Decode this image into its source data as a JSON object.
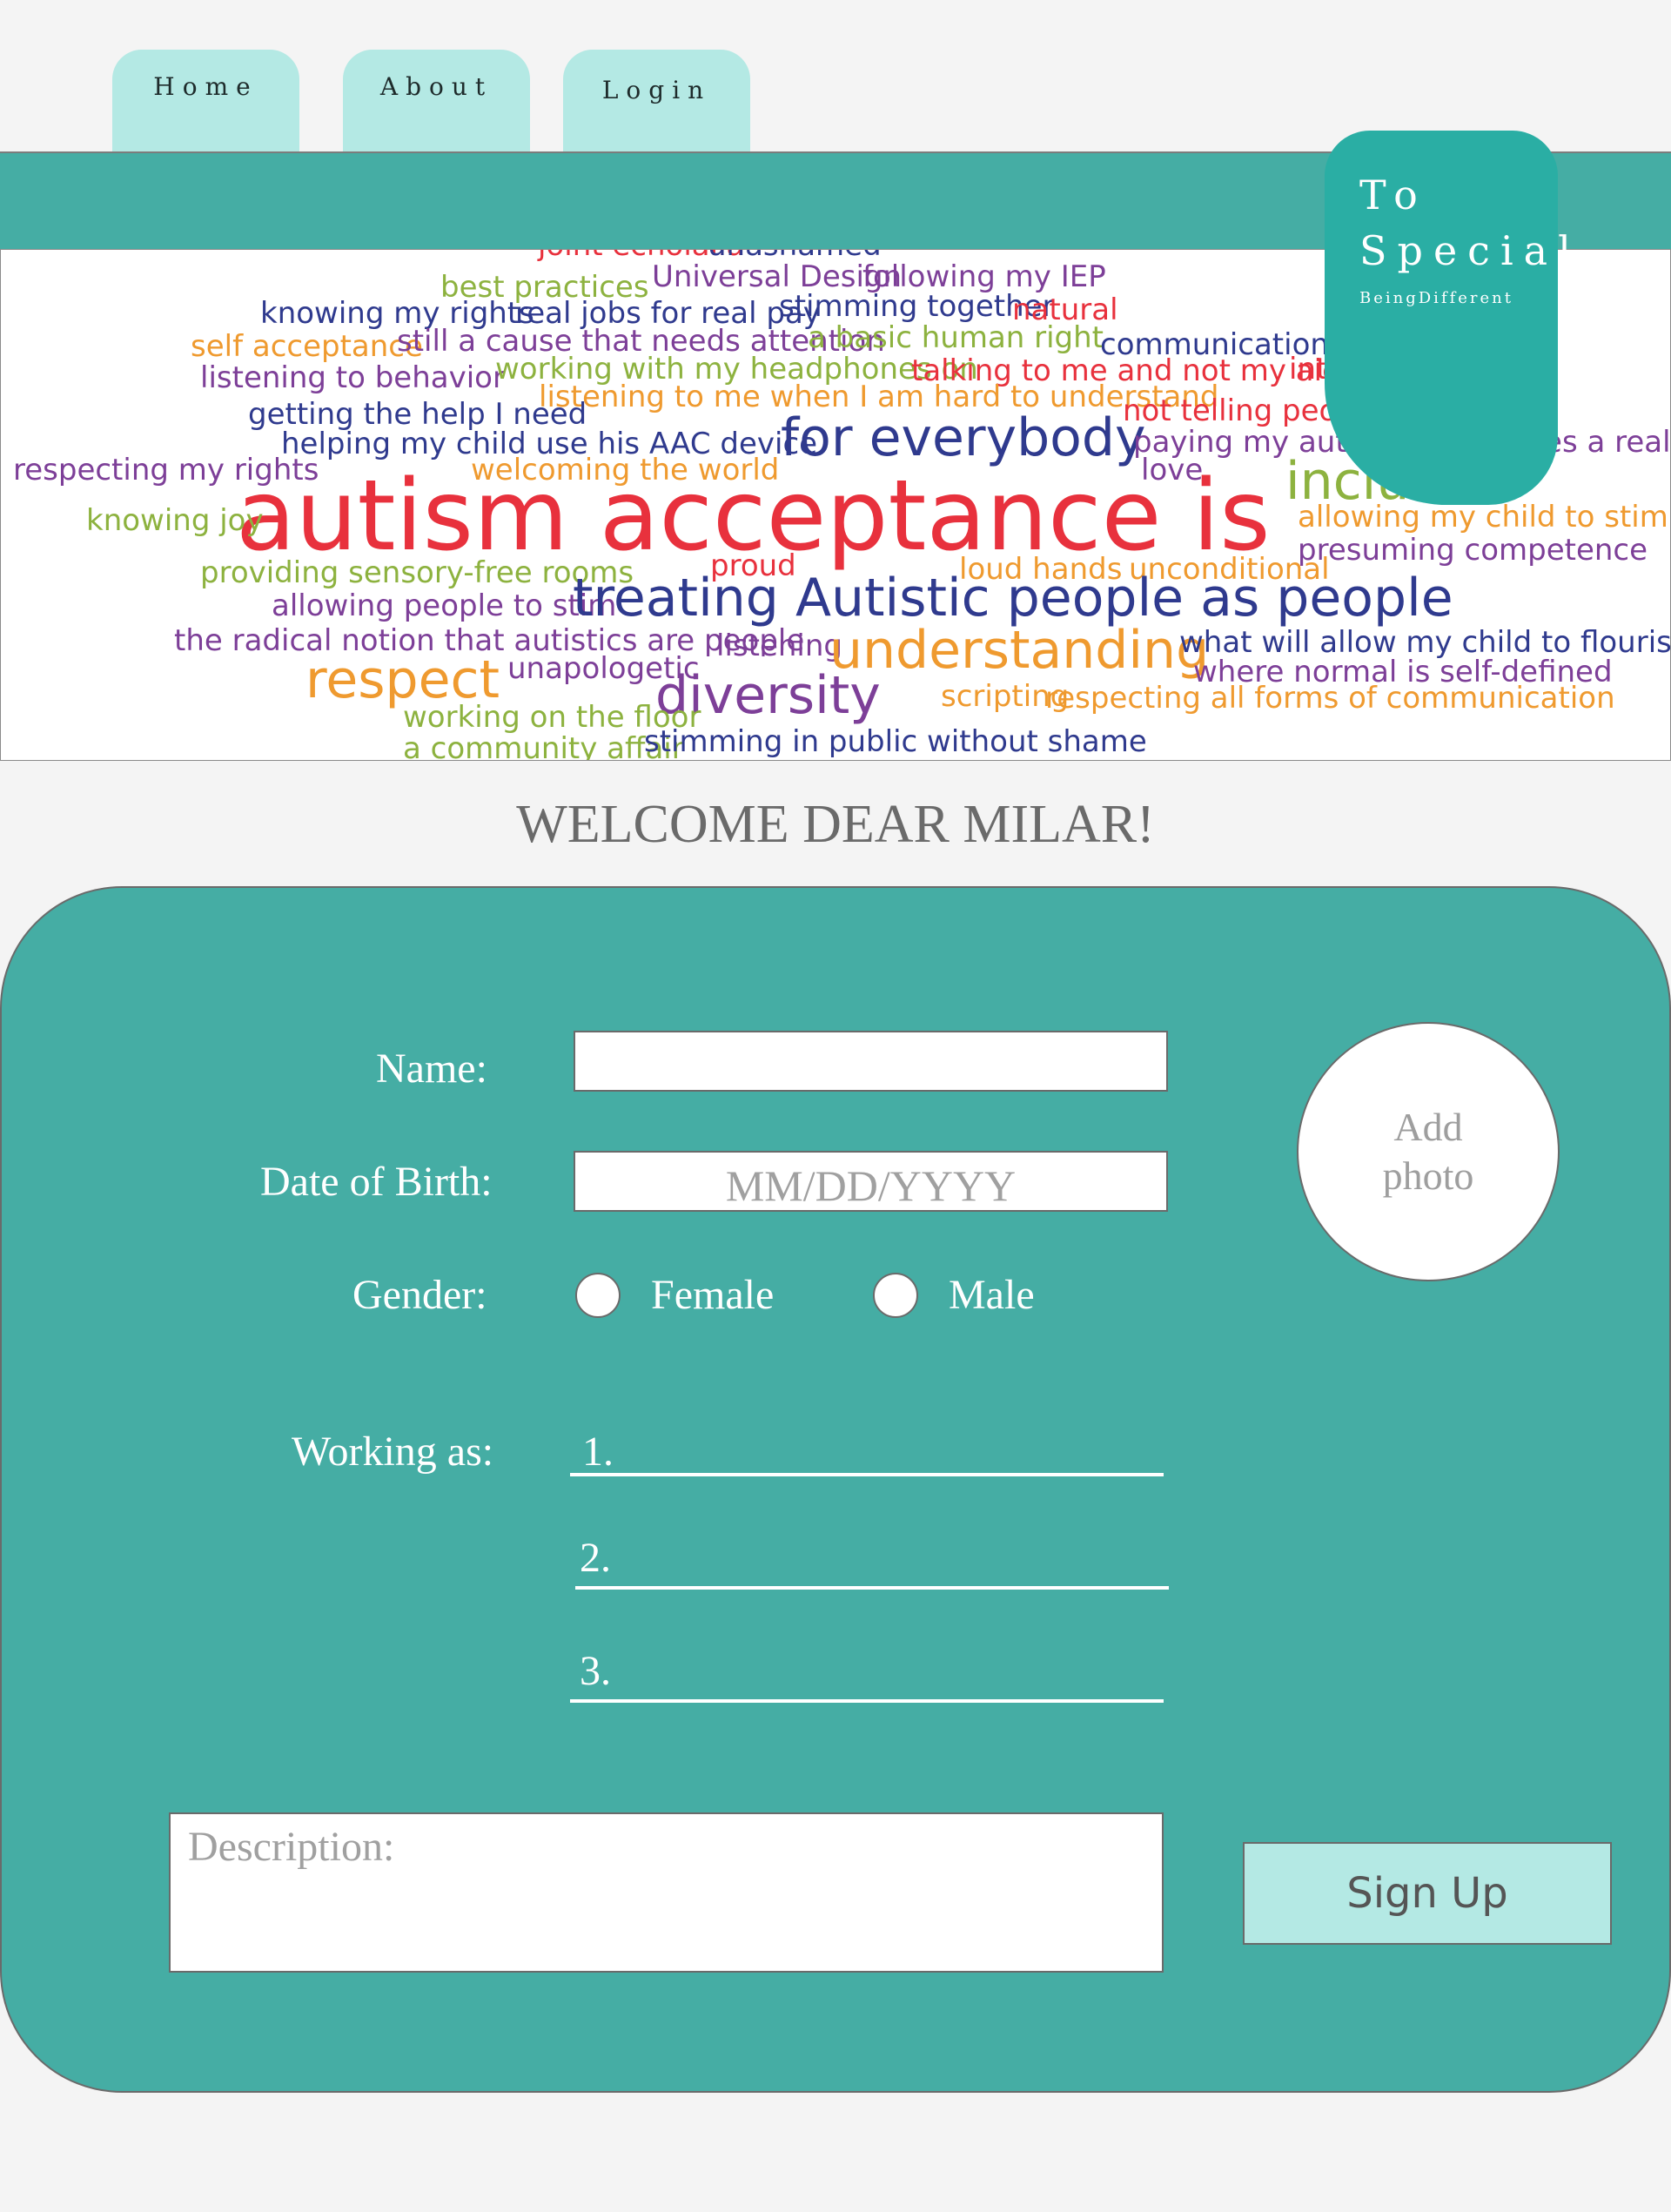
{
  "nav": {
    "tabs": [
      {
        "label": "Home"
      },
      {
        "label": "About"
      },
      {
        "label": "Login"
      }
    ]
  },
  "logo": {
    "line1": "To",
    "line2": "Special",
    "tagline": "BeingDifferent"
  },
  "banner": {
    "words": [
      {
        "text": "joint echolalia",
        "color": "#e8313d"
      },
      {
        "text": "unashamed",
        "color": "#2f3a8e"
      },
      {
        "text": "best practices",
        "color": "#8db23f"
      },
      {
        "text": "Universal Design",
        "color": "#7d3f98"
      },
      {
        "text": "following my IEP",
        "color": "#7d3f98"
      },
      {
        "text": "knowing my rights",
        "color": "#2f3a8e"
      },
      {
        "text": "real jobs for real pay",
        "color": "#2f3a8e"
      },
      {
        "text": "stimming together",
        "color": "#2f3a8e"
      },
      {
        "text": "natural",
        "color": "#e8313d"
      },
      {
        "text": "self acceptance",
        "color": "#ef9a2f"
      },
      {
        "text": "still a cause that needs attention",
        "color": "#7d3f98"
      },
      {
        "text": "a basic human right",
        "color": "#8db23f"
      },
      {
        "text": "communication",
        "color": "#2f3a8e"
      },
      {
        "text": "listening to behavior",
        "color": "#7d3f98"
      },
      {
        "text": "working with my headphones on",
        "color": "#8db23f"
      },
      {
        "text": "talking to me and not my aide",
        "color": "#e8313d"
      },
      {
        "text": "interests",
        "color": "#e8313d"
      },
      {
        "text": "listening to me when I am hard to understand",
        "color": "#ef9a2f"
      },
      {
        "text": "getting the help I need",
        "color": "#2f3a8e"
      },
      {
        "text": "not telling people to",
        "color": "#e8313d"
      },
      {
        "text": "helping my child use his AAC device",
        "color": "#2f3a8e"
      },
      {
        "text": "for everybody",
        "color": "#2f3a8e"
      },
      {
        "text": "paying my autistic employees a real wage",
        "color": "#7d3f98"
      },
      {
        "text": "respecting my rights",
        "color": "#7d3f98"
      },
      {
        "text": "welcoming the world",
        "color": "#ef9a2f"
      },
      {
        "text": "love",
        "color": "#7d3f98"
      },
      {
        "text": "inclusion",
        "color": "#8db23f"
      },
      {
        "text": "autism acceptance is",
        "color": "#e8313d"
      },
      {
        "text": "knowing joy",
        "color": "#8db23f"
      },
      {
        "text": "allowing my child to stim",
        "color": "#ef9a2f"
      },
      {
        "text": "presuming competence",
        "color": "#7d3f98"
      },
      {
        "text": "providing sensory-free rooms",
        "color": "#8db23f"
      },
      {
        "text": "proud",
        "color": "#e8313d"
      },
      {
        "text": "loud hands",
        "color": "#ef9a2f"
      },
      {
        "text": "unconditional",
        "color": "#ef9a2f"
      },
      {
        "text": "allowing people to stim",
        "color": "#7d3f98"
      },
      {
        "text": "treating Autistic people as people",
        "color": "#2f3a8e"
      },
      {
        "text": "the radical notion that autistics are people",
        "color": "#7d3f98"
      },
      {
        "text": "listening",
        "color": "#7d3f98"
      },
      {
        "text": "understanding",
        "color": "#ef9a2f"
      },
      {
        "text": "what will allow my child to flourish",
        "color": "#2f3a8e"
      },
      {
        "text": "respect",
        "color": "#ef9a2f"
      },
      {
        "text": "unapologetic",
        "color": "#7d3f98"
      },
      {
        "text": "where normal is self-defined",
        "color": "#7d3f98"
      },
      {
        "text": "diversity",
        "color": "#7d3f98"
      },
      {
        "text": "scripting",
        "color": "#ef9a2f"
      },
      {
        "text": "respecting all forms of communication",
        "color": "#ef9a2f"
      },
      {
        "text": "working on the floor",
        "color": "#8db23f"
      },
      {
        "text": "a community affair",
        "color": "#8db23f"
      },
      {
        "text": "stimming in public without shame",
        "color": "#2f3a8e"
      }
    ]
  },
  "welcome": "WELCOME DEAR MILAR!",
  "form": {
    "name_label": "Name:",
    "name_value": "",
    "dob_label": "Date of Birth:",
    "dob_placeholder": "MM/DD/YYYY",
    "gender_label": "Gender:",
    "gender_options": [
      "Female",
      "Male"
    ],
    "working_label": "Working as:",
    "working_items": [
      "1.",
      "2.",
      "3."
    ],
    "photo_line1": "Add",
    "photo_line2": "photo",
    "description_label": "Description:",
    "description_value": "",
    "signup_label": "Sign Up"
  },
  "colors": {
    "teal": "#45ada4",
    "logo_teal": "#2aaea4",
    "tab_mint": "#b4e9e4",
    "background": "#f4f4f4"
  }
}
